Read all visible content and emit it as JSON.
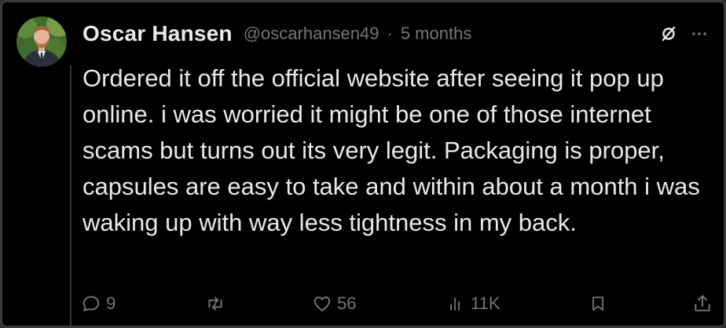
{
  "post": {
    "author_name": "Oscar Hansen",
    "handle": "@oscarhansen49",
    "separator": "·",
    "time": "5 months",
    "text": "Ordered it off the official website after seeing it pop up online. i was worried it might be one of those internet scams but turns out its very legit. Packaging is proper, capsules are easy to take and within about a month i was waking up with way less tightness in my back."
  },
  "actions": {
    "replies": "9",
    "reposts": "",
    "likes": "56",
    "views": "11K"
  },
  "icons": {
    "header": [
      "slashed-circle-icon",
      "more-icon"
    ],
    "actions": [
      "reply-icon",
      "repost-icon",
      "like-icon",
      "views-icon",
      "bookmark-icon",
      "share-icon"
    ]
  },
  "colors": {
    "background": "#000000",
    "text_primary": "#e7e9ea",
    "text_secondary": "#71767b"
  }
}
